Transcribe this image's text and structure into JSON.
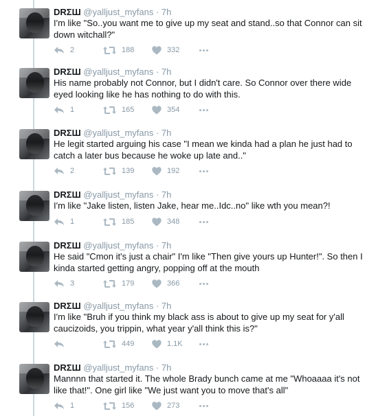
{
  "tweets": [
    {
      "name": "DRΣШ",
      "handle": "@yalljust_myfans",
      "time": "7h",
      "text": "I'm like \"So..you want me to give up my seat and stand..so that Connor can sit down witchall?\"",
      "replies": "2",
      "retweets": "188",
      "likes": "332"
    },
    {
      "name": "DRΣШ",
      "handle": "@yalljust_myfans",
      "time": "7h",
      "text": "His name probably not Connor, but I didn't care. So Connor over there wide eyed looking like he has nothing to do with this.",
      "replies": "1",
      "retweets": "165",
      "likes": "354"
    },
    {
      "name": "DRΣШ",
      "handle": "@yalljust_myfans",
      "time": "7h",
      "text": "He legit started arguing his case \"I mean we kinda had a plan he just had to catch a later bus because he woke up late and..\"",
      "replies": "2",
      "retweets": "139",
      "likes": "192"
    },
    {
      "name": "DRΣШ",
      "handle": "@yalljust_myfans",
      "time": "7h",
      "text": "I'm like \"Jake listen, listen Jake, hear me..Idc..no\" like wth you mean?!",
      "replies": "1",
      "retweets": "185",
      "likes": "348"
    },
    {
      "name": "DRΣШ",
      "handle": "@yalljust_myfans",
      "time": "7h",
      "text": "He said \"Cmon it's just a chair\" I'm like \"Then give yours up Hunter!\". So then I kinda started getting angry, popping off at the mouth",
      "replies": "3",
      "retweets": "179",
      "likes": "366"
    },
    {
      "name": "DRΣШ",
      "handle": "@yalljust_myfans",
      "time": "7h",
      "text": "I'm like \"Bruh if you think my black ass is about to give up my seat for y'all caucizoids, you trippin, what year y'all think this is?\"",
      "replies": "",
      "retweets": "449",
      "likes": "1.1K"
    },
    {
      "name": "DRΣШ",
      "handle": "@yalljust_myfans",
      "time": "7h",
      "text": "Mannnn that started it. The whole Brady bunch came at me \"Whoaaaa it's not like that!\". One girl like \"We just want you to move that's all\"",
      "replies": "1",
      "retweets": "156",
      "likes": "273"
    }
  ],
  "separator": " · ",
  "colors": {
    "text": "#14171a",
    "muted": "#8899a6",
    "line": "#ccd6dd"
  },
  "icons": {
    "reply": "reply-icon",
    "retweet": "retweet-icon",
    "like": "heart-icon",
    "more": "more-dots-icon"
  }
}
